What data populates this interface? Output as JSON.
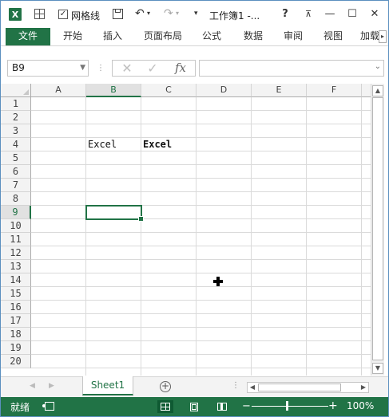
{
  "titlebar": {
    "app_logo": "X",
    "gridlines_check": "✓",
    "gridlines_label": "网格线",
    "undo_glyph": "↶",
    "redo_glyph": "↷",
    "qat_more_glyph": "▾",
    "title": "工作簿1 -...",
    "help_glyph": "?",
    "ribbon_display_glyph": "⊼",
    "minimize_glyph": "—",
    "maximize_glyph": "☐",
    "close_glyph": "✕"
  },
  "ribbon": {
    "tabs": [
      "文件",
      "开始",
      "插入",
      "页面布局",
      "公式",
      "数据",
      "审阅",
      "视图",
      "加载"
    ],
    "scroll_glyph": "▸"
  },
  "formula_bar": {
    "name_box": "B9",
    "name_box_arrow": "▼",
    "separator": "⋮",
    "cancel_glyph": "✕",
    "enter_glyph": "✓",
    "fx_glyph": "fx",
    "formula_value": "",
    "expand_glyph": "⌄"
  },
  "grid": {
    "columns": [
      "A",
      "B",
      "C",
      "D",
      "E",
      "F"
    ],
    "rows": [
      "1",
      "2",
      "3",
      "4",
      "5",
      "6",
      "7",
      "8",
      "9",
      "10",
      "11",
      "12",
      "13",
      "14",
      "15",
      "16",
      "17",
      "18",
      "19",
      "20"
    ],
    "selected_column": "B",
    "selected_row": "9",
    "cells": {
      "B4": "Excel",
      "C4": "Excel"
    }
  },
  "scrollbars": {
    "up": "▲",
    "down": "▼",
    "left": "◀",
    "right": "▶"
  },
  "sheet_tabs": {
    "prev": "◀",
    "next": "▶",
    "tabs": [
      "Sheet1"
    ],
    "add_glyph": "+",
    "more_glyph": "⋮"
  },
  "statusbar": {
    "status": "就绪",
    "zoom_minus": "−",
    "zoom_plus": "+",
    "zoom_level": "100%"
  },
  "colors": {
    "accent": "#217346",
    "grid_line": "#dadada",
    "header_bg": "#f3f3f3"
  }
}
